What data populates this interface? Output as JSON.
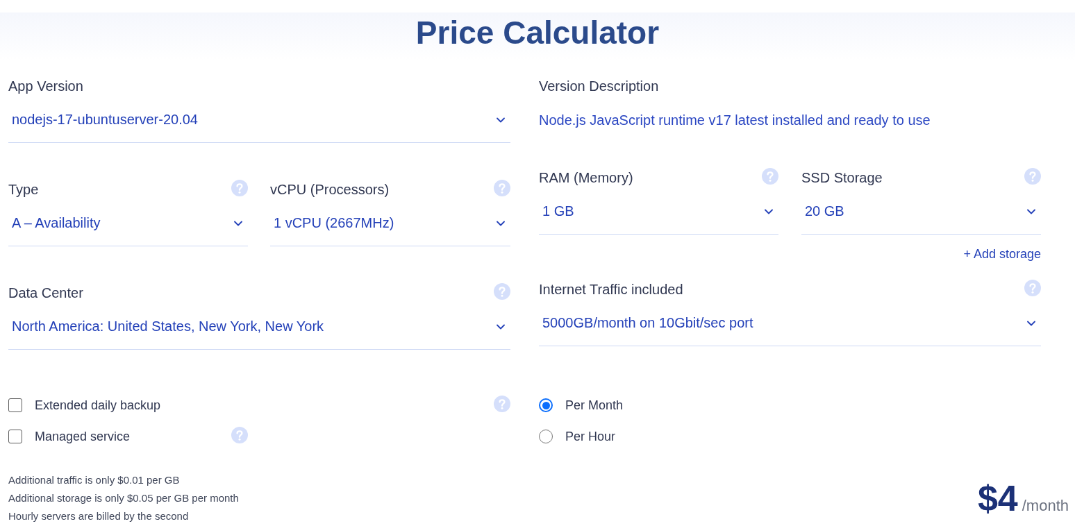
{
  "title": "Price Calculator",
  "app_version": {
    "label": "App Version",
    "value": "nodejs-17-ubuntuserver-20.04"
  },
  "version_description": {
    "label": "Version Description",
    "text": "Node.js JavaScript runtime v17 latest installed and ready to use"
  },
  "type": {
    "label": "Type",
    "value": "A – Availability",
    "help": true
  },
  "vcpu": {
    "label": "vCPU (Processors)",
    "value": "1 vCPU (2667MHz)",
    "help": true
  },
  "ram": {
    "label": "RAM (Memory)",
    "value": "1 GB",
    "help": true
  },
  "ssd_storage": {
    "label": "SSD Storage",
    "value": "20 GB",
    "help": true
  },
  "add_storage": "+ Add storage",
  "data_center": {
    "label": "Data Center",
    "value": "North America: United States, New York, New York",
    "help": true
  },
  "internet_traffic": {
    "label": "Internet Traffic included",
    "value": "5000GB/month on 10Gbit/sec port",
    "help": true
  },
  "options": [
    {
      "label": "Extended daily backup",
      "checked": false,
      "help": true
    },
    {
      "label": "Managed service",
      "checked": false,
      "help": true
    }
  ],
  "billing": [
    {
      "label": "Per Month",
      "selected": true
    },
    {
      "label": "Per Hour",
      "selected": false
    }
  ],
  "notes": [
    "Additional traffic is only $0.01 per GB",
    "Additional storage is only $0.05 per GB per month",
    "Hourly servers are billed by the second"
  ],
  "price": {
    "amount": "$4",
    "period": "/month"
  }
}
